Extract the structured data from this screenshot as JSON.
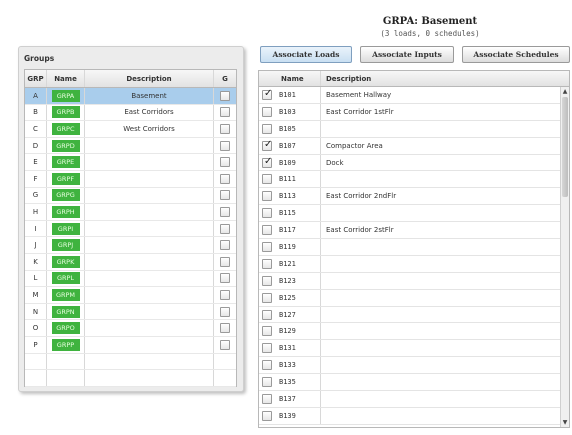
{
  "header": {
    "title": "GRPA: Basement",
    "subtitle": "(3 loads, 0 schedules)"
  },
  "groups": {
    "label": "Groups",
    "columns": [
      "GRP",
      "Name",
      "Description",
      "G"
    ],
    "rows": [
      {
        "grp": "A",
        "name": "GRPA",
        "description": "Basement",
        "checked": false,
        "selected": true
      },
      {
        "grp": "B",
        "name": "GRPB",
        "description": "East Corridors",
        "checked": false
      },
      {
        "grp": "C",
        "name": "GRPC",
        "description": "West Corridors",
        "checked": false
      },
      {
        "grp": "D",
        "name": "GRPD",
        "description": "",
        "checked": false
      },
      {
        "grp": "E",
        "name": "GRPE",
        "description": "",
        "checked": false
      },
      {
        "grp": "F",
        "name": "GRPF",
        "description": "",
        "checked": false
      },
      {
        "grp": "G",
        "name": "GRPG",
        "description": "",
        "checked": false
      },
      {
        "grp": "H",
        "name": "GRPH",
        "description": "",
        "checked": false
      },
      {
        "grp": "I",
        "name": "GRPI",
        "description": "",
        "checked": false
      },
      {
        "grp": "J",
        "name": "GRPJ",
        "description": "",
        "checked": false
      },
      {
        "grp": "K",
        "name": "GRPK",
        "description": "",
        "checked": false
      },
      {
        "grp": "L",
        "name": "GRPL",
        "description": "",
        "checked": false
      },
      {
        "grp": "M",
        "name": "GRPM",
        "description": "",
        "checked": false
      },
      {
        "grp": "N",
        "name": "GRPN",
        "description": "",
        "checked": false
      },
      {
        "grp": "O",
        "name": "GRPO",
        "description": "",
        "checked": false
      },
      {
        "grp": "P",
        "name": "GRPP",
        "description": "",
        "checked": false
      }
    ]
  },
  "buttons": {
    "loads": "Associate Loads",
    "inputs": "Associate Inputs",
    "schedules": "Associate Schedules"
  },
  "loads": {
    "columns": [
      "Name",
      "Description"
    ],
    "rows": [
      {
        "name": "B101",
        "description": "Basement Hallway",
        "checked": true
      },
      {
        "name": "B103",
        "description": "East Corridor 1stFlr",
        "checked": false
      },
      {
        "name": "B105",
        "description": "",
        "checked": false
      },
      {
        "name": "B107",
        "description": "Compactor Area",
        "checked": true
      },
      {
        "name": "B109",
        "description": "Dock",
        "checked": true
      },
      {
        "name": "B111",
        "description": "",
        "checked": false
      },
      {
        "name": "B113",
        "description": "East Corridor 2ndFlr",
        "checked": false
      },
      {
        "name": "B115",
        "description": "",
        "checked": false
      },
      {
        "name": "B117",
        "description": "East Corridor 2stFlr",
        "checked": false
      },
      {
        "name": "B119",
        "description": "",
        "checked": false
      },
      {
        "name": "B121",
        "description": "",
        "checked": false
      },
      {
        "name": "B123",
        "description": "",
        "checked": false
      },
      {
        "name": "B125",
        "description": "",
        "checked": false
      },
      {
        "name": "B127",
        "description": "",
        "checked": false
      },
      {
        "name": "B129",
        "description": "",
        "checked": false
      },
      {
        "name": "B131",
        "description": "",
        "checked": false
      },
      {
        "name": "B133",
        "description": "",
        "checked": false
      },
      {
        "name": "B135",
        "description": "",
        "checked": false
      },
      {
        "name": "B137",
        "description": "",
        "checked": false
      },
      {
        "name": "B139",
        "description": "",
        "checked": false
      }
    ]
  },
  "colors": {
    "name_chip": "#3fb33f",
    "selected_row": "#a9cdec"
  }
}
